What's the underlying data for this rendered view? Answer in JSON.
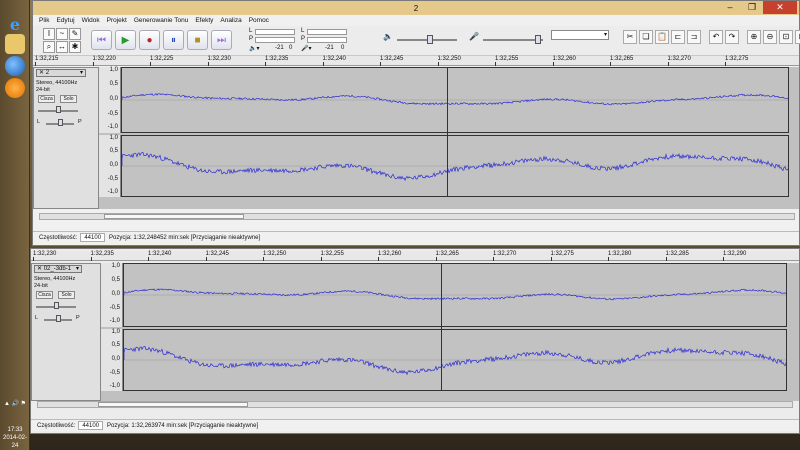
{
  "taskbar": {
    "clock_time": "17:33",
    "clock_date": "2014-02-24",
    "tray_label": "▲ 🔊 ⚑"
  },
  "window_top": {
    "title": "2",
    "menu": [
      "Plik",
      "Edytuj",
      "Widok",
      "Projekt",
      "Generowanie Tonu",
      "Efekty",
      "Analiza",
      "Pomoc"
    ],
    "meter_values": [
      "-21",
      "0",
      "-21",
      "0"
    ],
    "ruler": [
      "1:32,215",
      "1:32,220",
      "1:32,225",
      "1:32,230",
      "1:32,235",
      "1:32,240",
      "1:32,245",
      "1:32,250",
      "1:32,255",
      "1:32,260",
      "1:32,265",
      "1:32,270",
      "1:32,275"
    ],
    "track": {
      "name": "2",
      "format": "Stereo, 44100Hz",
      "bits": "24-bit",
      "mute": "Cisza",
      "solo": "Solo",
      "left": "L",
      "right": "P"
    },
    "scale": [
      "1,0",
      "0,5",
      "0,0",
      "-0,5",
      "-1,0"
    ],
    "status_label": "Częstotliwość:",
    "status_rate": "44100",
    "status_pos": "Pozycja: 1:32,248452 min:sek  [Przyciąganie nieaktywne]"
  },
  "window_bottom": {
    "ruler": [
      "1:32,230",
      "1:32,235",
      "1:32,240",
      "1:32,245",
      "1:32,250",
      "1:32,255",
      "1:32,260",
      "1:32,265",
      "1:32,270",
      "1:32,275",
      "1:32,280",
      "1:32,285",
      "1:32,290"
    ],
    "track": {
      "name": "02_-3db-1",
      "format": "Stereo, 44100Hz",
      "bits": "24-bit",
      "mute": "Cisza",
      "solo": "Solo",
      "left": "L",
      "right": "P"
    },
    "scale": [
      "1,0",
      "0,5",
      "0,0",
      "-0,5",
      "-1,0"
    ],
    "status_label": "Częstotliwość:",
    "status_rate": "44100",
    "status_pos": "Pozycja: 1:32,263974 min:sek  [Przyciąganie nieaktywne]"
  },
  "colors": {
    "wave": "#2b2bd4",
    "wave_bg": "#c2c2c2",
    "title_bg": "#e4c98a"
  }
}
